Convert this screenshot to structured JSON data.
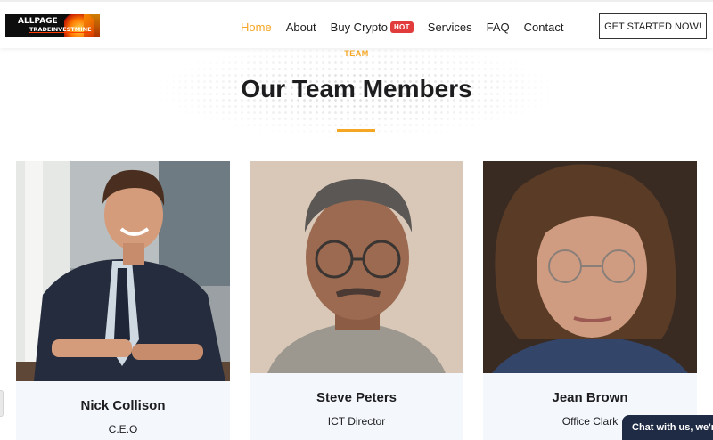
{
  "header": {
    "logo": {
      "line1": "ALLPAGE",
      "line2": "TRADEINVESTMINE"
    },
    "nav": [
      {
        "label": "Home",
        "active": true
      },
      {
        "label": "About"
      },
      {
        "label": "Buy Crypto",
        "badge": "HOT"
      },
      {
        "label": "Services"
      },
      {
        "label": "FAQ"
      },
      {
        "label": "Contact"
      }
    ],
    "cta_label": "GET STARTED NOW!"
  },
  "section": {
    "eyebrow": "TEAM",
    "title": "Our Team Members"
  },
  "team": [
    {
      "name": "Nick Collison",
      "role": "C.E.O",
      "photo": "man-in-suit-smiling-photo"
    },
    {
      "name": "Steve Peters",
      "role": "ICT Director",
      "photo": "older-man-glasses-photo"
    },
    {
      "name": "Jean Brown",
      "role": "Office Clark",
      "photo": "woman-curly-hair-glasses-photo"
    }
  ],
  "chat_label": "Chat with us, we're",
  "colors": {
    "accent": "#f5a623",
    "hot_badge": "#e23b3b",
    "card_bg": "#f4f8fd",
    "chat_bg": "#1f2a44"
  }
}
